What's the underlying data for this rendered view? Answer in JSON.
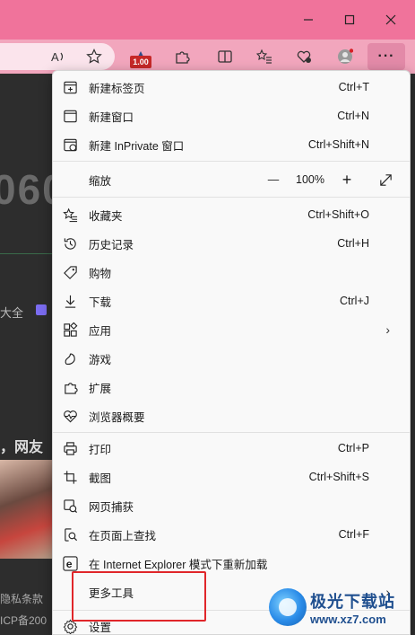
{
  "background": {
    "big_number": "060",
    "texts": [
      {
        "key": "t1",
        "text": "大全"
      },
      {
        "key": "t2",
        "text": "，网友"
      },
      {
        "key": "t3",
        "text": "隐私条款"
      },
      {
        "key": "t4",
        "text": "ICP备200"
      }
    ]
  },
  "toolbar": {
    "badge": "1.00",
    "more_label": "···"
  },
  "menu": {
    "new_tab": {
      "label": "新建标签页",
      "shortcut": "Ctrl+T"
    },
    "new_window": {
      "label": "新建窗口",
      "shortcut": "Ctrl+N"
    },
    "new_inprivate": {
      "label": "新建 InPrivate 窗口",
      "shortcut": "Ctrl+Shift+N"
    },
    "zoom": {
      "label": "缩放",
      "minus": "—",
      "value": "100%",
      "plus": "+"
    },
    "favorites": {
      "label": "收藏夹",
      "shortcut": "Ctrl+Shift+O"
    },
    "history": {
      "label": "历史记录",
      "shortcut": "Ctrl+H"
    },
    "shopping": {
      "label": "购物"
    },
    "downloads": {
      "label": "下载",
      "shortcut": "Ctrl+J"
    },
    "apps": {
      "label": "应用",
      "arrow": "›"
    },
    "games": {
      "label": "游戏"
    },
    "extensions": {
      "label": "扩展"
    },
    "essentials": {
      "label": "浏览器概要"
    },
    "print": {
      "label": "打印",
      "shortcut": "Ctrl+P"
    },
    "screenshot": {
      "label": "截图",
      "shortcut": "Ctrl+Shift+S"
    },
    "web_capture": {
      "label": "网页捕获"
    },
    "find": {
      "label": "在页面上查找",
      "shortcut": "Ctrl+F"
    },
    "ie_mode": {
      "label": "在 Internet Explorer 模式下重新加载"
    },
    "more_tools": {
      "label": "更多工具",
      "arrow": "›"
    },
    "settings": {
      "label": "设置"
    }
  },
  "watermark": {
    "name": "极光下载站",
    "url": "www.xz7.com"
  },
  "colors": {
    "titlebar": "#f0739b",
    "toolbar": "#f2a6bd",
    "highlight": "#e0262a"
  }
}
